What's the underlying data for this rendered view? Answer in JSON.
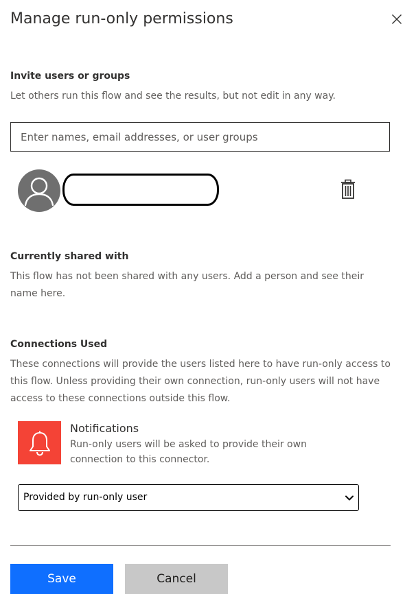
{
  "panel": {
    "title": "Manage run-only permissions"
  },
  "invite": {
    "heading": "Invite users or groups",
    "description": "Let others run this flow and see the results, but not edit in any way.",
    "placeholder": "Enter names, email addresses, or user groups",
    "value": ""
  },
  "invited_user": {
    "avatar_icon": "person-icon",
    "name": "",
    "delete_icon": "trash-icon"
  },
  "shared": {
    "heading": "Currently shared with",
    "description": "This flow has not been shared with any users. Add a person and see their name here."
  },
  "connections": {
    "heading": "Connections Used",
    "description": "These connections will provide the users listed here to have run-only access to this flow. Unless providing their own connection, run-only users will not have access to these connections outside this flow.",
    "items": [
      {
        "icon": "bell-icon",
        "icon_color": "#f44336",
        "name": "Notifications",
        "description": "Run-only users will be asked to provide their own connection to this connector.",
        "selected_option": "Provided by run-only user"
      }
    ]
  },
  "footer": {
    "save_label": "Save",
    "cancel_label": "Cancel"
  },
  "colors": {
    "primary": "#0f6fff",
    "secondary_button": "#c8c8c8",
    "avatar_bg": "#6f6f6f"
  }
}
